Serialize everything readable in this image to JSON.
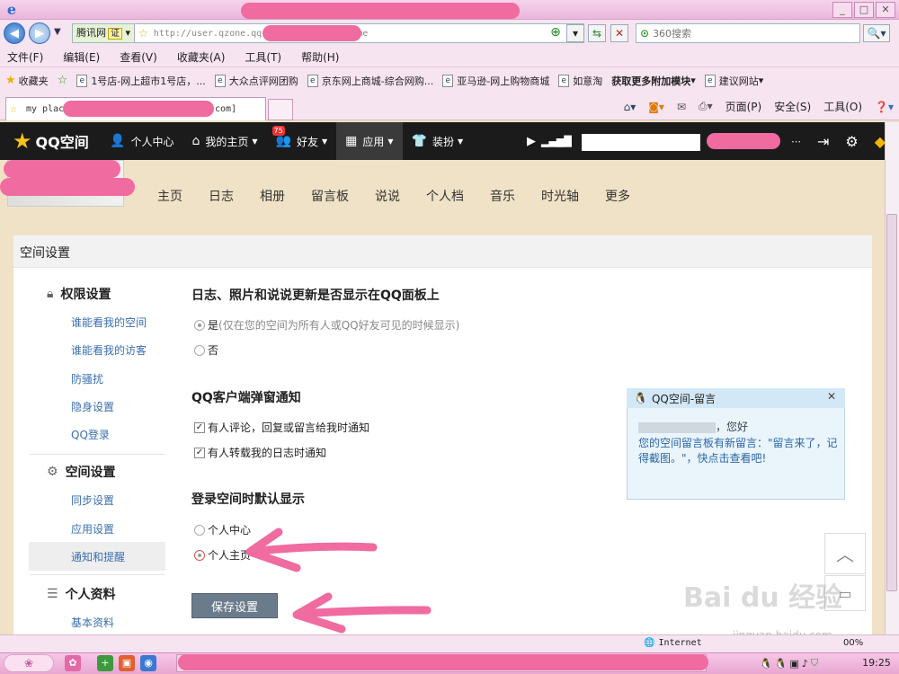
{
  "window": {
    "title": "Internet Explorer"
  },
  "address": {
    "site_id": "腾讯网",
    "cert": "证",
    "url": "http://user.qzone.qq",
    "url_tail": "ome",
    "search_placeholder": "360搜索"
  },
  "menu": [
    "文件(F)",
    "编辑(E)",
    "查看(V)",
    "收藏夹(A)",
    "工具(T)",
    "帮助(H)"
  ],
  "favorites": {
    "label": "收藏夹",
    "items": [
      "1号店-网上超市1号店，...",
      "大众点评网团购",
      "京东网上商城-综合网购...",
      "亚马逊-网上购物商城",
      "如意淘",
      "获取更多附加模块",
      "建议网站"
    ]
  },
  "tab": {
    "title": "my plac",
    "title_tail": "com]"
  },
  "commandbar": [
    "页面(P)",
    "安全(S)",
    "工具(O)"
  ],
  "qq": {
    "logo": "QQ空间",
    "nav": [
      {
        "label": "个人中心",
        "icon": "person-icon"
      },
      {
        "label": "我的主页",
        "icon": "home-icon"
      },
      {
        "label": "好友",
        "icon": "friends-icon",
        "badge": "75"
      },
      {
        "label": "应用",
        "icon": "apps-icon"
      },
      {
        "label": "装扮",
        "icon": "shirt-icon"
      }
    ]
  },
  "profile_nav": [
    "主页",
    "日志",
    "相册",
    "留言板",
    "说说",
    "个人档",
    "音乐",
    "时光轴",
    "更多"
  ],
  "settings": {
    "title": "空间设置",
    "groups": [
      {
        "name": "权限设置",
        "links": [
          "谁能看我的空间",
          "谁能看我的访客",
          "防骚扰",
          "隐身设置",
          "QQ登录"
        ]
      },
      {
        "name": "空间设置",
        "links": [
          "同步设置",
          "应用设置",
          "通知和提醒"
        ]
      },
      {
        "name": "个人资料",
        "links": [
          "基本资料"
        ]
      }
    ],
    "sections": [
      {
        "title": "日志、照片和说说更新是否显示在QQ面板上",
        "options": [
          {
            "label": "是",
            "hint": "(仅在您的空间为所有人或QQ好友可见的时候显示)",
            "checked": true
          },
          {
            "label": "否",
            "hint": "",
            "checked": false
          }
        ]
      },
      {
        "title": "QQ客户端弹窗通知",
        "options": [
          {
            "label": "有人评论，回复或留言给我时通知",
            "checked": true
          },
          {
            "label": "有人转载我的日志时通知",
            "checked": true
          }
        ]
      },
      {
        "title": "登录空间时默认显示",
        "options": [
          {
            "label": "个人中心",
            "checked": false
          },
          {
            "label": "个人主页",
            "checked": true
          }
        ]
      }
    ],
    "save_label": "保存设置"
  },
  "popup": {
    "title": "QQ空间-留言",
    "greeting": "，您好",
    "body": "您的空间留言板有新留言：\"留言来了，记得截图。\"，快点击查看吧!"
  },
  "status": {
    "zone": "Internet",
    "zoom": "00%"
  },
  "taskbar": {
    "clock": "19:25"
  },
  "watermark": {
    "text": "Bai du 经验",
    "sub": "jingyan.baidu.com"
  }
}
